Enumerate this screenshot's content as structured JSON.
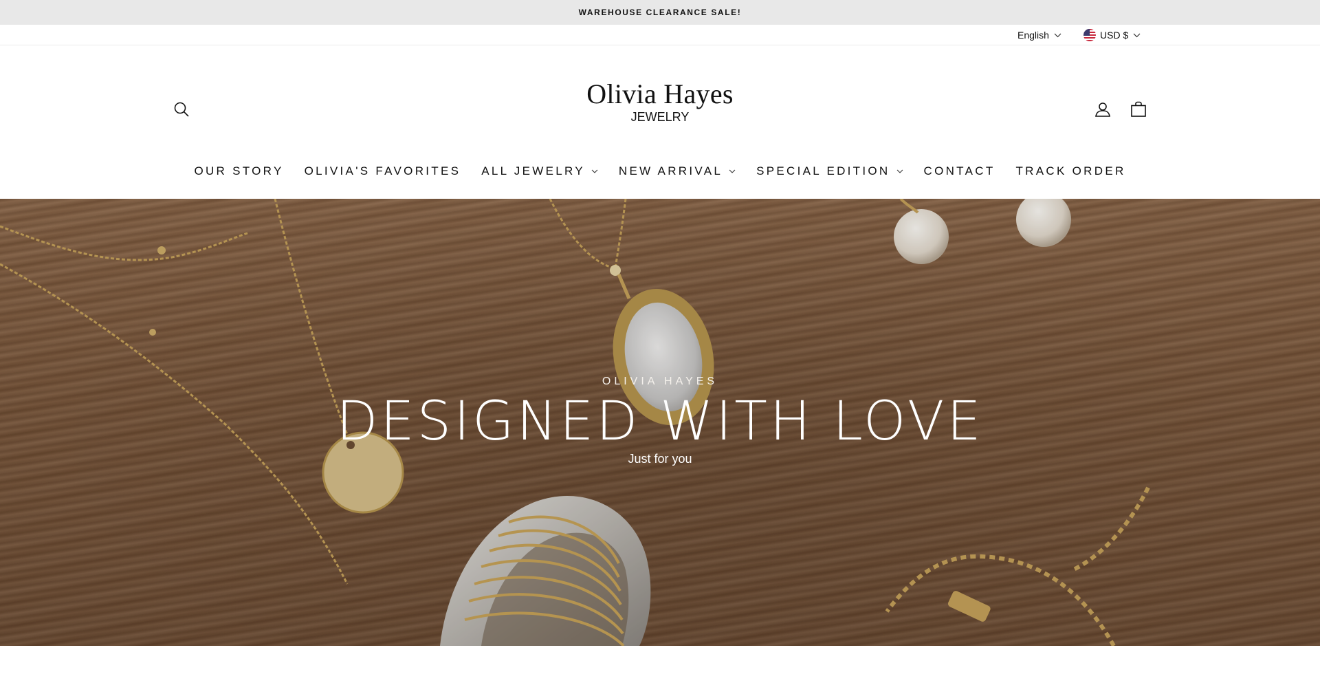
{
  "announcement": {
    "text": "WAREHOUSE CLEARANCE SALE!"
  },
  "utility": {
    "language": {
      "label": "English",
      "icon": "chevron-down-icon"
    },
    "currency": {
      "label": "USD $",
      "flag_icon": "us-flag-icon",
      "icon": "chevron-down-icon"
    }
  },
  "header": {
    "logo": {
      "name": "Olivia Hayes",
      "tagline": "JEWELRY"
    },
    "icons": {
      "search": "search-icon",
      "account": "user-icon",
      "cart": "bag-icon"
    }
  },
  "nav": {
    "items": [
      {
        "label": "OUR STORY",
        "has_dropdown": false
      },
      {
        "label": "OLIVIA'S FAVORITES",
        "has_dropdown": false
      },
      {
        "label": "ALL JEWELRY",
        "has_dropdown": true
      },
      {
        "label": "NEW ARRIVAL",
        "has_dropdown": true
      },
      {
        "label": "SPECIAL EDITION",
        "has_dropdown": true
      },
      {
        "label": "CONTACT",
        "has_dropdown": false
      },
      {
        "label": "TRACK ORDER",
        "has_dropdown": false
      }
    ]
  },
  "hero": {
    "eyebrow": "OLIVIA HAYES",
    "title": "DESIGNED WITH LOVE",
    "subtitle": "Just for you",
    "background": "jewelry-on-wood-image"
  },
  "colors": {
    "announcement_bg": "#e8e8e8",
    "text": "#111111",
    "hero_text": "#ffffff",
    "wood": "#7d5a3f"
  }
}
